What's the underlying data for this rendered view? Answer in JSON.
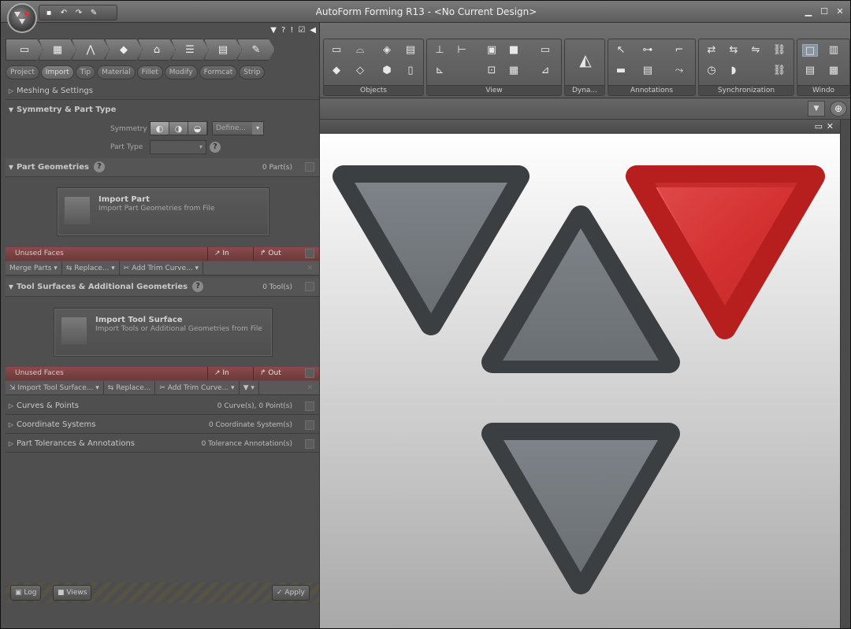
{
  "app": {
    "title": "AutoForm Forming R13 - <No Current Design>"
  },
  "qat": {
    "icons": [
      "save-icon",
      "undo-icon",
      "redo-icon",
      "settings-icon"
    ],
    "glyphs": [
      "▪",
      "↶",
      "↷",
      "✎"
    ]
  },
  "tabs": [
    "Project",
    "Import",
    "Tip",
    "Material",
    "Fillet",
    "Modify",
    "Formcat",
    "Strip"
  ],
  "active_tab": "Import",
  "sections": {
    "meshing": "Meshing & Settings",
    "symmetry": "Symmetry & Part Type",
    "symmetry_label": "Symmetry",
    "define_label": "Define...",
    "parttype_label": "Part Type",
    "part_geometries": "Part Geometries",
    "part_count": "0 Part(s)",
    "import_part_title": "Import Part",
    "import_part_sub": "Import Part Geometries from File",
    "unused_faces": "Unused Faces",
    "in_label": "In",
    "out_label": "Out",
    "merge_parts": "Merge Parts",
    "replace": "Replace...",
    "add_trim": "Add Trim Curve...",
    "tool_surfaces": "Tool Surfaces & Additional Geometries",
    "tool_count": "0 Tool(s)",
    "import_tool_title": "Import Tool Surface",
    "import_tool_sub": "Import Tools or Additional Geometries from File",
    "import_tool_btn": "Import Tool Surface...",
    "curves": "Curves & Points",
    "curves_count": "0 Curve(s), 0 Point(s)",
    "coords": "Coordinate Systems",
    "coords_count": "0 Coordinate System(s)",
    "tolerances": "Part Tolerances & Annotations",
    "tolerances_count": "0 Tolerance Annotation(s)"
  },
  "footer": {
    "log": "Log",
    "views": "Views",
    "apply": "Apply"
  },
  "ribbon": {
    "groups": [
      "Objects",
      "View",
      "Dyna...",
      "Annotations",
      "Synchronization",
      "Windo"
    ]
  },
  "colors": {
    "accent_red": "#cc2a2a",
    "panel": "#4f4f4f",
    "unused_bar": "#7a4242"
  }
}
